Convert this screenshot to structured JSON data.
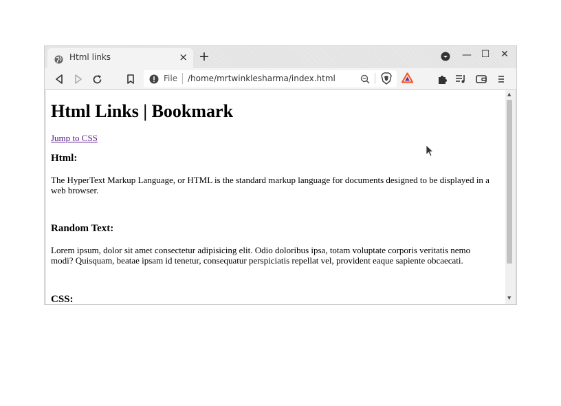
{
  "tab": {
    "title": "Html links",
    "close": "×"
  },
  "new_tab": "+",
  "window_controls": {
    "minimize": "—",
    "maximize": "☐",
    "close": "✕"
  },
  "address": {
    "scheme": "File",
    "path": "/home/mrtwinklesharma/index.html"
  },
  "icons": {
    "menu_down": "chevron-down-icon",
    "back": "back-icon",
    "forward": "forward-icon",
    "reload": "reload-icon",
    "bookmark": "bookmark-icon",
    "info": "info-icon",
    "zoom": "zoom-icon",
    "brave": "brave-shield-icon",
    "rewards": "rewards-triangle-icon",
    "extensions": "puzzle-icon",
    "playlist": "playlist-icon",
    "wallet": "wallet-icon",
    "menu": "hamburger-menu-icon"
  },
  "colors": {
    "link_visited": "#551a8b",
    "brave_orange": "#fb542b",
    "rewards_purple": "#662d91"
  },
  "page": {
    "heading": "Html Links | Bookmark",
    "jump_link": "Jump to CSS",
    "html_heading": "Html:",
    "html_text": "The HyperText Markup Language, or HTML is the standard markup language for documents designed to be displayed in a web browser.",
    "random_heading": "Random Text:",
    "random_text": "Lorem ipsum, dolor sit amet consectetur adipisicing elit. Odio doloribus ipsa, totam voluptate corporis veritatis nemo modi? Quisquam, beatae ipsam id tenetur, consequatur perspiciatis repellat vel, provident eaque sapiente obcaecati.",
    "css_heading": "CSS:"
  }
}
